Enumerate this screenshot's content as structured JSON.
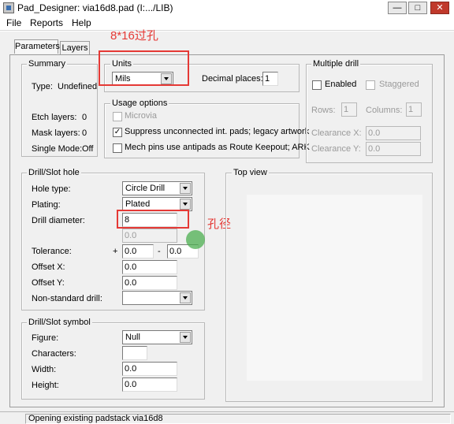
{
  "window": {
    "title": "Pad_Designer: via16d8.pad (I:.../LIB)",
    "buttons": [
      "—",
      "□",
      "✕"
    ]
  },
  "menu": [
    "File",
    "Reports",
    "Help"
  ],
  "tabs": [
    "Parameters",
    "Layers"
  ],
  "summary": {
    "title": "Summary",
    "type_label": "Type:",
    "type_value": "Undefined",
    "etch_label": "Etch layers:",
    "etch_value": "0",
    "mask_label": "Mask layers:",
    "mask_value": "0",
    "single_label": "Single Mode:",
    "single_value": "Off"
  },
  "units": {
    "title": "Units",
    "value": "Mils",
    "decimal_label": "Decimal places:",
    "decimal_value": "1"
  },
  "usage": {
    "title": "Usage options",
    "microvia": "Microvia",
    "suppress": "Suppress unconnected int. pads; legacy artwork",
    "suppress_checked": "✓",
    "mech": "Mech pins use antipads as Route Keepout; ARK"
  },
  "multiple_drill": {
    "title": "Multiple drill",
    "enabled": "Enabled",
    "staggered": "Staggered",
    "rows_label": "Rows:",
    "rows_value": "1",
    "columns_label": "Columns:",
    "columns_value": "1",
    "clearance_x_label": "Clearance X:",
    "clearance_x_value": "0.0",
    "clearance_y_label": "Clearance Y:",
    "clearance_y_value": "0.0"
  },
  "drill": {
    "title": "Drill/Slot hole",
    "hole_type_label": "Hole type:",
    "hole_type_value": "Circle Drill",
    "plating_label": "Plating:",
    "plating_value": "Plated",
    "diameter_label": "Drill diameter:",
    "diameter_value": "8",
    "diameter_secondary": "0.0",
    "tolerance_label": "Tolerance:",
    "tol_plus": "+",
    "tol_plus_value": "0.0",
    "tol_minus": "-",
    "tol_minus_value": "0.0",
    "offset_x_label": "Offset X:",
    "offset_x_value": "0.0",
    "offset_y_label": "Offset Y:",
    "offset_y_value": "0.0",
    "nonstandard_label": "Non-standard drill:",
    "nonstandard_value": ""
  },
  "symbol": {
    "title": "Drill/Slot symbol",
    "figure_label": "Figure:",
    "figure_value": "Null",
    "characters_label": "Characters:",
    "characters_value": "",
    "width_label": "Width:",
    "width_value": "0.0",
    "height_label": "Height:",
    "height_value": "0.0"
  },
  "top_view": {
    "title": "Top view"
  },
  "annotations": {
    "units_note": "8*16过孔",
    "drill_note": "孔径",
    "color": "#e53935"
  },
  "status": "Opening existing padstack via16d8"
}
